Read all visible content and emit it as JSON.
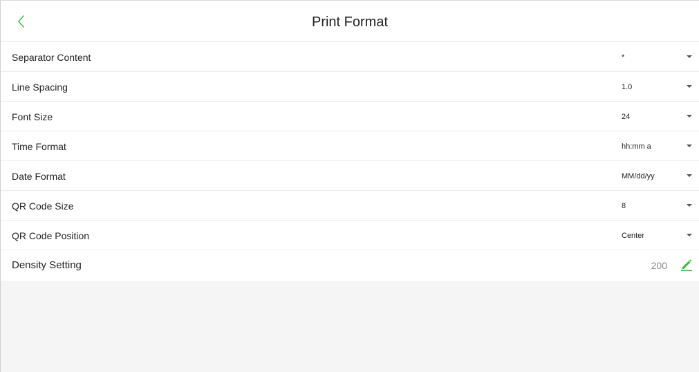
{
  "colors": {
    "accent": "#3dbb3f",
    "background": "#f5f5f5",
    "surface": "#ffffff",
    "divider": "#ececec",
    "muted_text": "#8a8a8a"
  },
  "header": {
    "title": "Print Format",
    "back_icon": "chevron-left-icon"
  },
  "settings": [
    {
      "label": "Separator Content",
      "value": "*"
    },
    {
      "label": "Line Spacing",
      "value": "1.0"
    },
    {
      "label": "Font Size",
      "value": "24"
    },
    {
      "label": "Time Format",
      "value": "hh:mm a"
    },
    {
      "label": "Date Format",
      "value": "MM/dd/yy"
    },
    {
      "label": "QR Code Size",
      "value": "8"
    },
    {
      "label": "QR Code Position",
      "value": "Center"
    }
  ],
  "density": {
    "label": "Density Setting",
    "value": "200",
    "edit_icon": "pencil-icon"
  }
}
